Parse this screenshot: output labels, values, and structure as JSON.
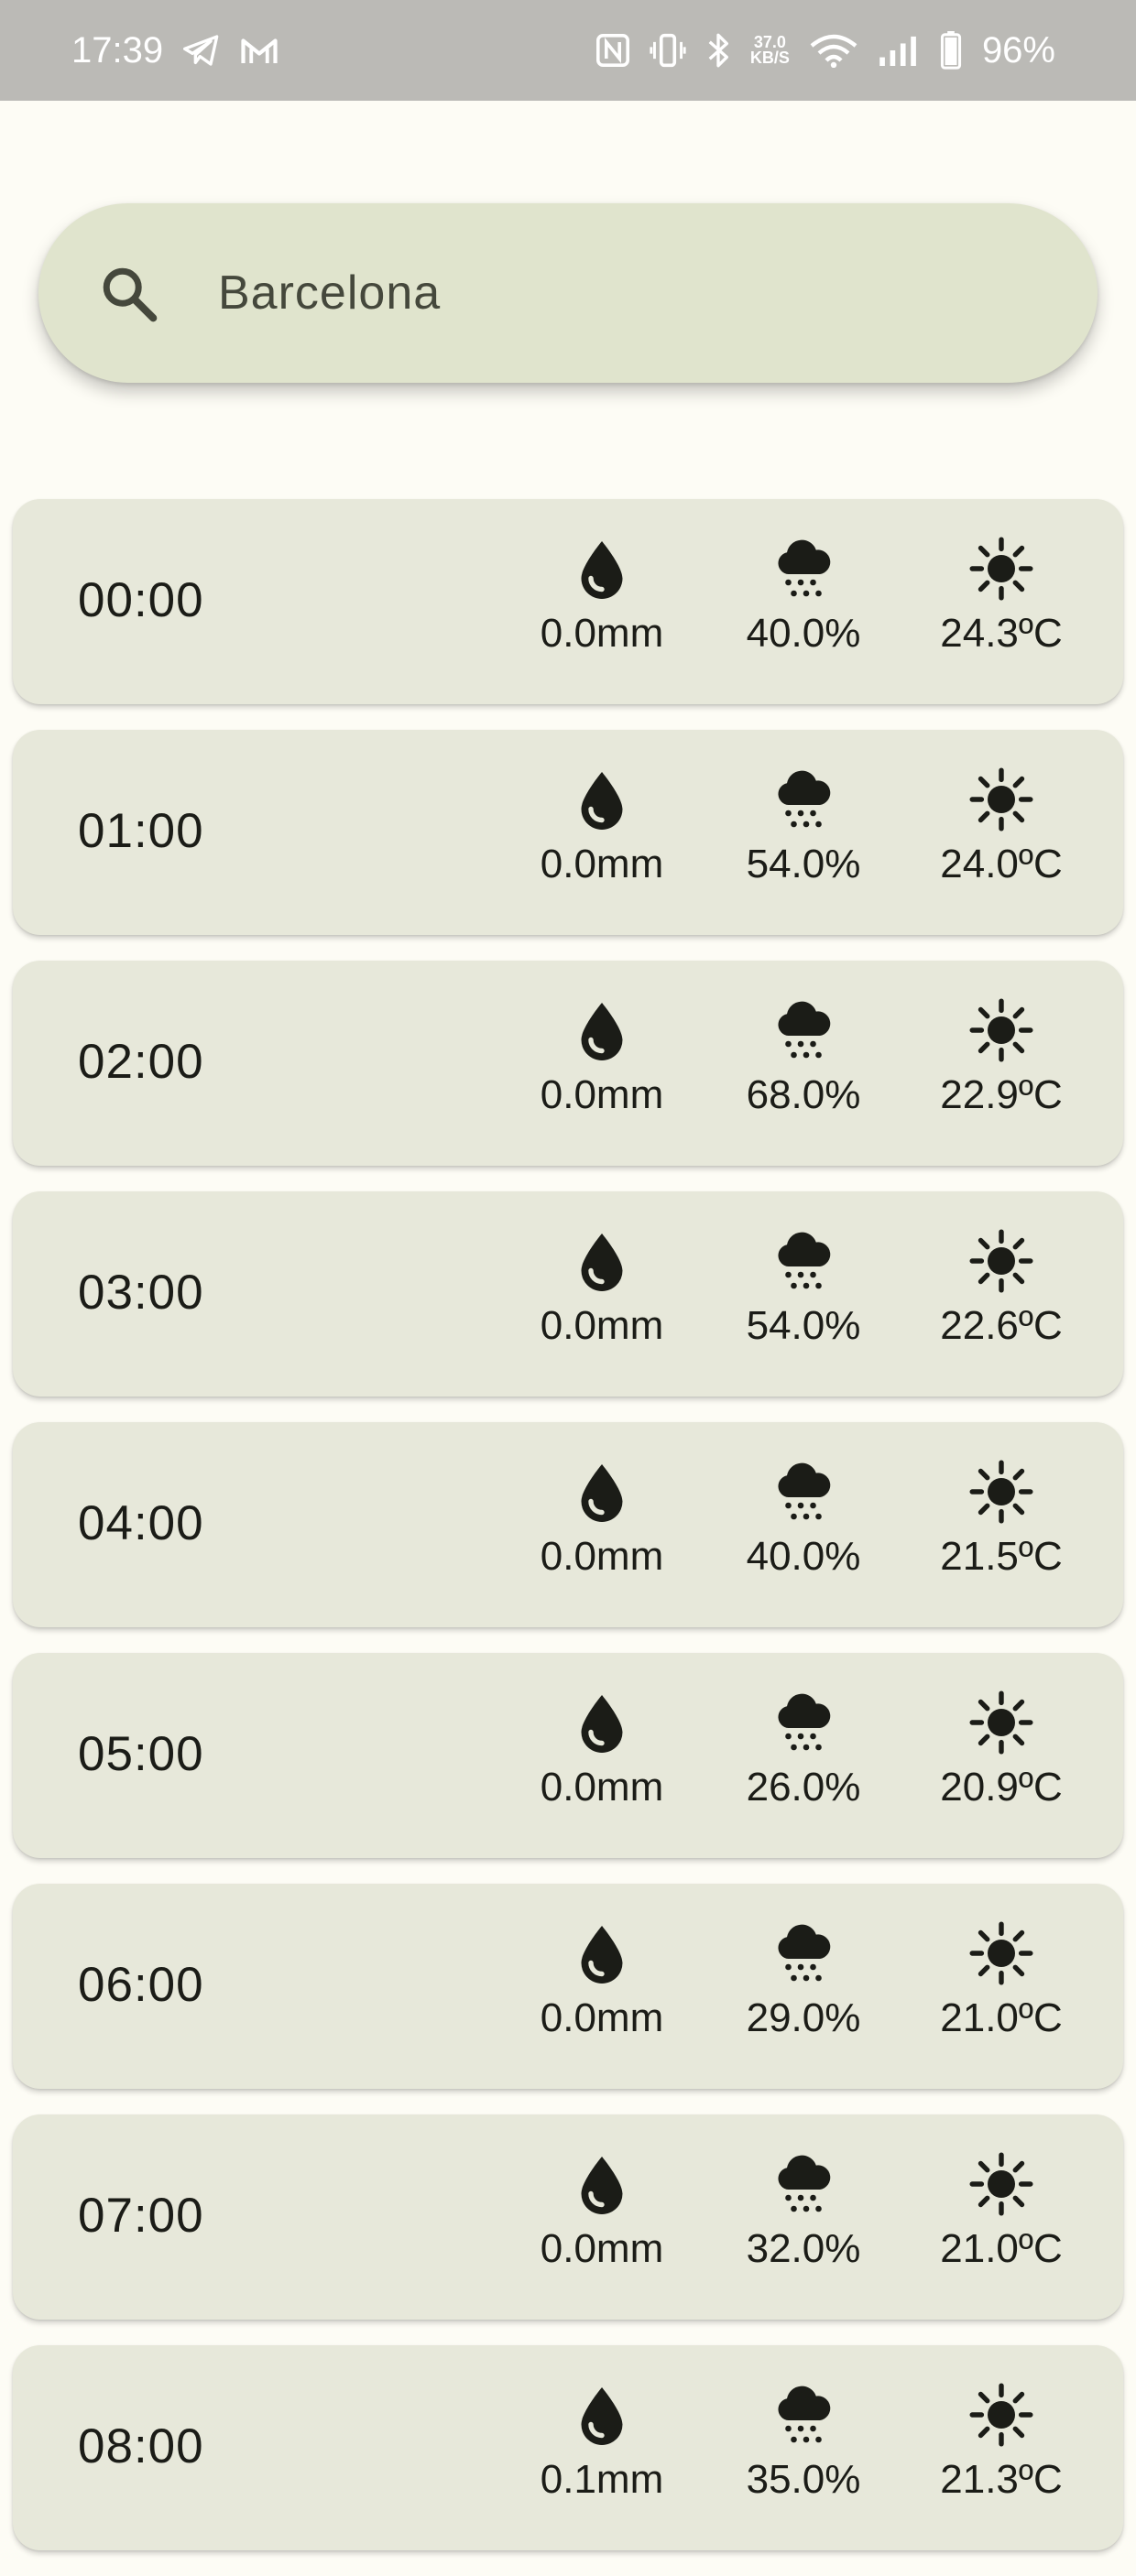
{
  "status_bar": {
    "time": "17:39",
    "netspeed_value": "37.0",
    "netspeed_unit": "KB/S",
    "battery": "96%",
    "icons": [
      "telegram-icon",
      "gmail-icon",
      "nfc-icon",
      "vibrate-icon",
      "bluetooth-icon",
      "wifi-icon",
      "signal-icon",
      "battery-icon"
    ]
  },
  "search": {
    "value": "Barcelona",
    "icon": "search-icon"
  },
  "forecast": [
    {
      "time": "00:00",
      "precip": "0.0mm",
      "cloud": "40.0%",
      "temp": "24.3ºC"
    },
    {
      "time": "01:00",
      "precip": "0.0mm",
      "cloud": "54.0%",
      "temp": "24.0ºC"
    },
    {
      "time": "02:00",
      "precip": "0.0mm",
      "cloud": "68.0%",
      "temp": "22.9ºC"
    },
    {
      "time": "03:00",
      "precip": "0.0mm",
      "cloud": "54.0%",
      "temp": "22.6ºC"
    },
    {
      "time": "04:00",
      "precip": "0.0mm",
      "cloud": "40.0%",
      "temp": "21.5ºC"
    },
    {
      "time": "05:00",
      "precip": "0.0mm",
      "cloud": "26.0%",
      "temp": "20.9ºC"
    },
    {
      "time": "06:00",
      "precip": "0.0mm",
      "cloud": "29.0%",
      "temp": "21.0ºC"
    },
    {
      "time": "07:00",
      "precip": "0.0mm",
      "cloud": "32.0%",
      "temp": "21.0ºC"
    },
    {
      "time": "08:00",
      "precip": "0.1mm",
      "cloud": "35.0%",
      "temp": "21.3ºC"
    }
  ],
  "metric_icons": {
    "precip": "water-drop-icon",
    "cloud": "cloud-snow-icon",
    "temp": "sun-icon"
  },
  "colors": {
    "background": "#fdfcf5",
    "status_bar": "#bbbab6",
    "search_bg": "#e0e4cd",
    "card_bg": "#e7e8da",
    "text": "#1b1c17"
  }
}
